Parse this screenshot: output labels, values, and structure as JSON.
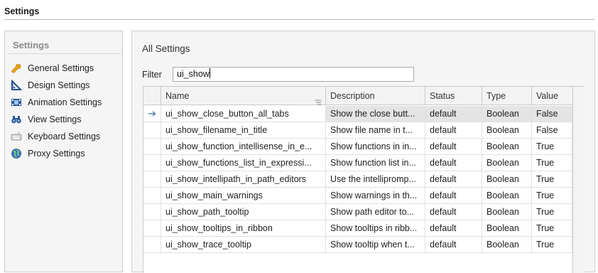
{
  "page": {
    "title": "Settings"
  },
  "sidebar": {
    "header": "Settings",
    "items": [
      {
        "label": "General Settings",
        "icon": "wrench-icon"
      },
      {
        "label": "Design Settings",
        "icon": "ruler-icon"
      },
      {
        "label": "Animation Settings",
        "icon": "film-icon"
      },
      {
        "label": "View Settings",
        "icon": "binoculars-icon"
      },
      {
        "label": "Keyboard Settings",
        "icon": "keyboard-icon"
      },
      {
        "label": "Proxy Settings",
        "icon": "globe-icon"
      }
    ]
  },
  "main": {
    "heading": "All Settings",
    "filter": {
      "label": "Filter",
      "value": "ui_show"
    },
    "columns": [
      "Name",
      "Description",
      "Status",
      "Type",
      "Value"
    ],
    "rows": [
      {
        "name": "ui_show_close_button_all_tabs",
        "description": "Show the close butt...",
        "status": "default",
        "type": "Boolean",
        "value": "False"
      },
      {
        "name": "ui_show_filename_in_title",
        "description": "Show file name in t...",
        "status": "default",
        "type": "Boolean",
        "value": "False"
      },
      {
        "name": "ui_show_function_intellisense_in_e...",
        "description": "Show functions in in...",
        "status": "default",
        "type": "Boolean",
        "value": "True"
      },
      {
        "name": "ui_show_functions_list_in_expressi...",
        "description": "Show function list in...",
        "status": "default",
        "type": "Boolean",
        "value": "True"
      },
      {
        "name": "ui_show_intellipath_in_path_editors",
        "description": "Use the intellipromp...",
        "status": "default",
        "type": "Boolean",
        "value": "True"
      },
      {
        "name": "ui_show_main_warnings",
        "description": "Show warnings in th...",
        "status": "default",
        "type": "Boolean",
        "value": "True"
      },
      {
        "name": "ui_show_path_tooltip",
        "description": "Show path editor to...",
        "status": "default",
        "type": "Boolean",
        "value": "True"
      },
      {
        "name": "ui_show_tooltips_in_ribbon",
        "description": "Show tooltips in ribb...",
        "status": "default",
        "type": "Boolean",
        "value": "True"
      },
      {
        "name": "ui_show_trace_tooltip",
        "description": "Show tooltip when t...",
        "status": "default",
        "type": "Boolean",
        "value": "True"
      }
    ]
  }
}
